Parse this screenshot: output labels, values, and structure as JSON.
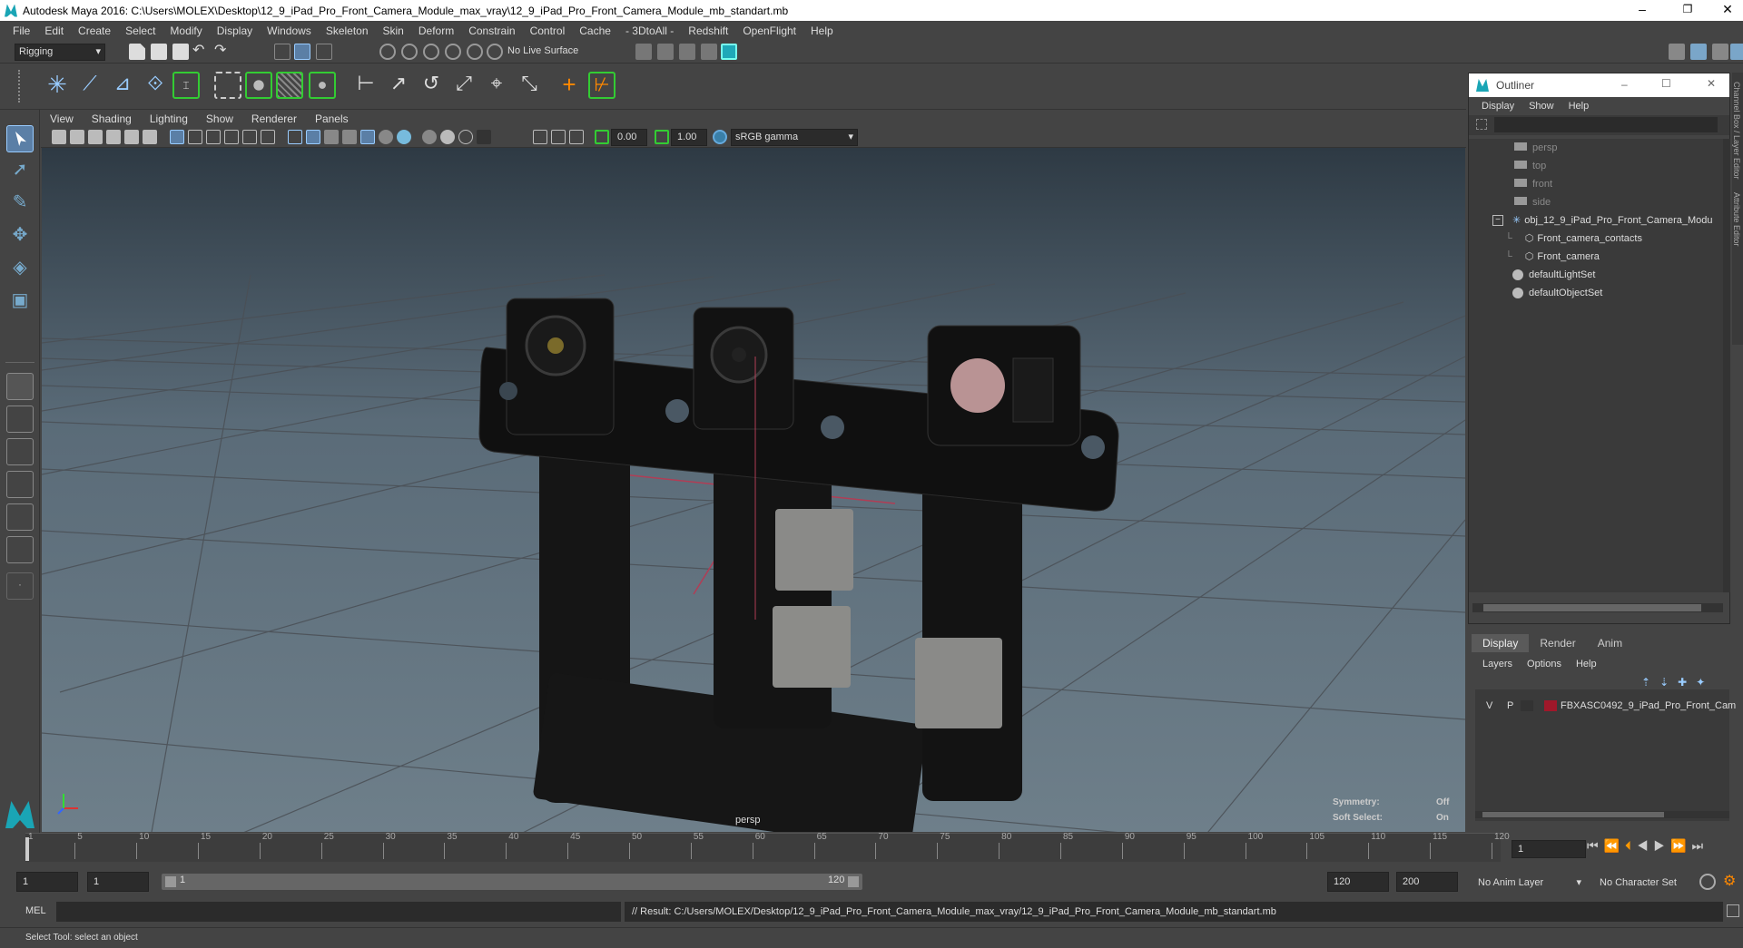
{
  "window": {
    "title": "Autodesk Maya 2016: C:\\Users\\MOLEX\\Desktop\\12_9_iPad_Pro_Front_Camera_Module_max_vray\\12_9_iPad_Pro_Front_Camera_Module_mb_standart.mb"
  },
  "menubar": [
    "File",
    "Edit",
    "Create",
    "Select",
    "Modify",
    "Display",
    "Windows",
    "Skeleton",
    "Skin",
    "Deform",
    "Constrain",
    "Control",
    "Cache",
    "- 3DtoAll -",
    "Redshift",
    "OpenFlight",
    "Help"
  ],
  "statusline": {
    "menuset": "Rigging",
    "live_surface": "No Live Surface"
  },
  "viewport": {
    "menus": [
      "View",
      "Shading",
      "Lighting",
      "Show",
      "Renderer",
      "Panels"
    ],
    "exposure": "0.00",
    "gamma": "1.00",
    "colorspace": "sRGB gamma",
    "camera_label": "persp",
    "symmetry_label": "Symmetry:",
    "symmetry_value": "Off",
    "soft_select_label": "Soft Select:",
    "soft_select_value": "On"
  },
  "outliner": {
    "title": "Outliner",
    "menus": [
      "Display",
      "Show",
      "Help"
    ],
    "items": [
      {
        "label": "persp",
        "type": "camera",
        "dim": true
      },
      {
        "label": "top",
        "type": "camera",
        "dim": true
      },
      {
        "label": "front",
        "type": "camera",
        "dim": true
      },
      {
        "label": "side",
        "type": "camera",
        "dim": true
      },
      {
        "label": "obj_12_9_iPad_Pro_Front_Camera_Modu",
        "type": "group",
        "dim": false
      },
      {
        "label": "Front_camera_contacts",
        "type": "mesh",
        "dim": false
      },
      {
        "label": "Front_camera",
        "type": "mesh",
        "dim": false
      },
      {
        "label": "defaultLightSet",
        "type": "set",
        "dim": false
      },
      {
        "label": "defaultObjectSet",
        "type": "set",
        "dim": false
      }
    ]
  },
  "layer_editor": {
    "tabs": [
      "Display",
      "Render",
      "Anim"
    ],
    "menus": [
      "Layers",
      "Options",
      "Help"
    ],
    "layer": {
      "v": "V",
      "p": "P",
      "name": "FBXASC0492_9_iPad_Pro_Front_Cam",
      "color": "#a0182a"
    }
  },
  "timeline": {
    "ticks": [
      1,
      5,
      10,
      15,
      20,
      25,
      30,
      35,
      40,
      45,
      50,
      55,
      60,
      65,
      70,
      75,
      80,
      85,
      90,
      95,
      100,
      105,
      110,
      115,
      120
    ],
    "current_frame": "1"
  },
  "range": {
    "start": "1",
    "playback_start": "1",
    "range_thumb_start": "1",
    "range_thumb_end": "120",
    "playback_end": "120",
    "end": "200",
    "anim_layer": "No Anim Layer",
    "character_set": "No Character Set"
  },
  "command": {
    "lang": "MEL",
    "result": "// Result: C:/Users/MOLEX/Desktop/12_9_iPad_Pro_Front_Camera_Module_max_vray/12_9_iPad_Pro_Front_Camera_Module_mb_standart.mb"
  },
  "helpline": "Select Tool: select an object",
  "side_tabs": [
    "Channel Box / Layer Editor",
    "Attribute Editor"
  ]
}
